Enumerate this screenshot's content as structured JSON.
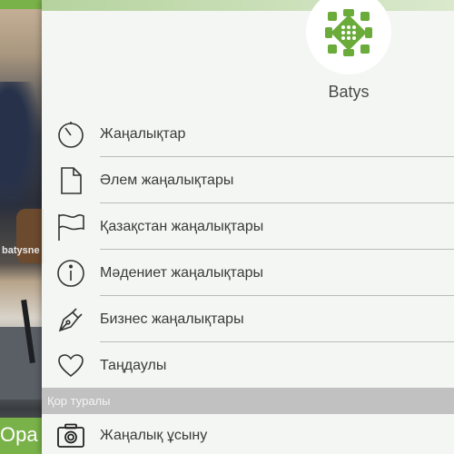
{
  "app": {
    "brand": "Batys",
    "accent": "#6aab3a"
  },
  "background": {
    "watermark": "batysne",
    "bottom_label": "Opa"
  },
  "menu": {
    "items": [
      {
        "label": "Жаңалықтар",
        "icon": "timer-icon"
      },
      {
        "label": "Әлем жаңалықтары",
        "icon": "document-icon"
      },
      {
        "label": "Қазақстан жаңалықтары",
        "icon": "flag-icon"
      },
      {
        "label": "Мәдениет жаңалықтары",
        "icon": "info-icon"
      },
      {
        "label": "Бизнес жаңалықтары",
        "icon": "pen-nib-icon"
      },
      {
        "label": "Таңдаулы",
        "icon": "heart-icon"
      }
    ],
    "section_title": "Қор туралы",
    "bottom_item": {
      "label": "Жаңалық ұсыну",
      "icon": "camera-icon"
    }
  }
}
